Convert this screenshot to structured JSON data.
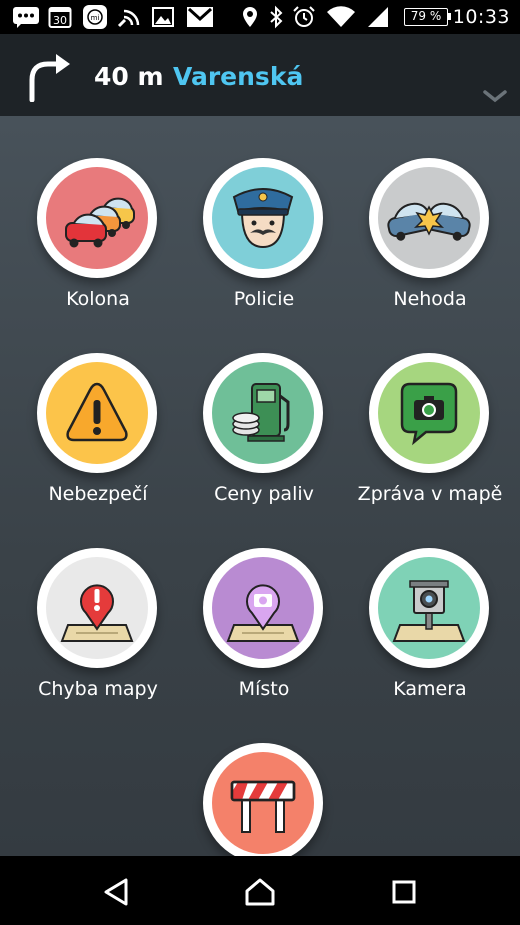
{
  "status_bar": {
    "time": "10:33",
    "battery": "79 %",
    "icons": [
      "messages-icon",
      "calendar-30-icon",
      "mi-fit-icon",
      "wifi-calling-icon",
      "gallery-icon",
      "gmail-icon",
      "location-icon",
      "bluetooth-icon",
      "alarm-icon",
      "wifi-icon",
      "signal-icon",
      "battery-icon"
    ],
    "calendar_day": "30"
  },
  "navigation": {
    "distance": "40 m",
    "street": "Varenská",
    "turn_direction": "turn-right-icon",
    "street_color": "#4fc6f1"
  },
  "reports": [
    {
      "id": "kolona",
      "label": "Kolona",
      "icon": "traffic-jam-icon",
      "bg": "#e87a7c"
    },
    {
      "id": "policie",
      "label": "Policie",
      "icon": "police-icon",
      "bg": "#7fcfd8"
    },
    {
      "id": "nehoda",
      "label": "Nehoda",
      "icon": "accident-icon",
      "bg": "#c9cbcc"
    },
    {
      "id": "nebezpeci",
      "label": "Nebezpečí",
      "icon": "hazard-icon",
      "bg": "#fcc44a"
    },
    {
      "id": "ceny-paliv",
      "label": "Ceny paliv",
      "icon": "gas-station-icon",
      "bg": "#6fbf98"
    },
    {
      "id": "zprava-v-mape",
      "label": "Zpráva v mapě",
      "icon": "map-chat-icon",
      "bg": "#a6d67f"
    },
    {
      "id": "chyba-mapy",
      "label": "Chyba mapy",
      "icon": "map-error-icon",
      "bg": "#e9e9e9"
    },
    {
      "id": "misto",
      "label": "Místo",
      "icon": "place-icon",
      "bg": "#b98bd2"
    },
    {
      "id": "kamera",
      "label": "Kamera",
      "icon": "speed-camera-icon",
      "bg": "#7fd2b6"
    },
    {
      "id": "uzavirka",
      "label": "",
      "icon": "road-closure-icon",
      "bg": "#f4816a"
    }
  ],
  "android_nav": {
    "icons": [
      "back-icon",
      "home-icon",
      "recents-icon"
    ]
  }
}
